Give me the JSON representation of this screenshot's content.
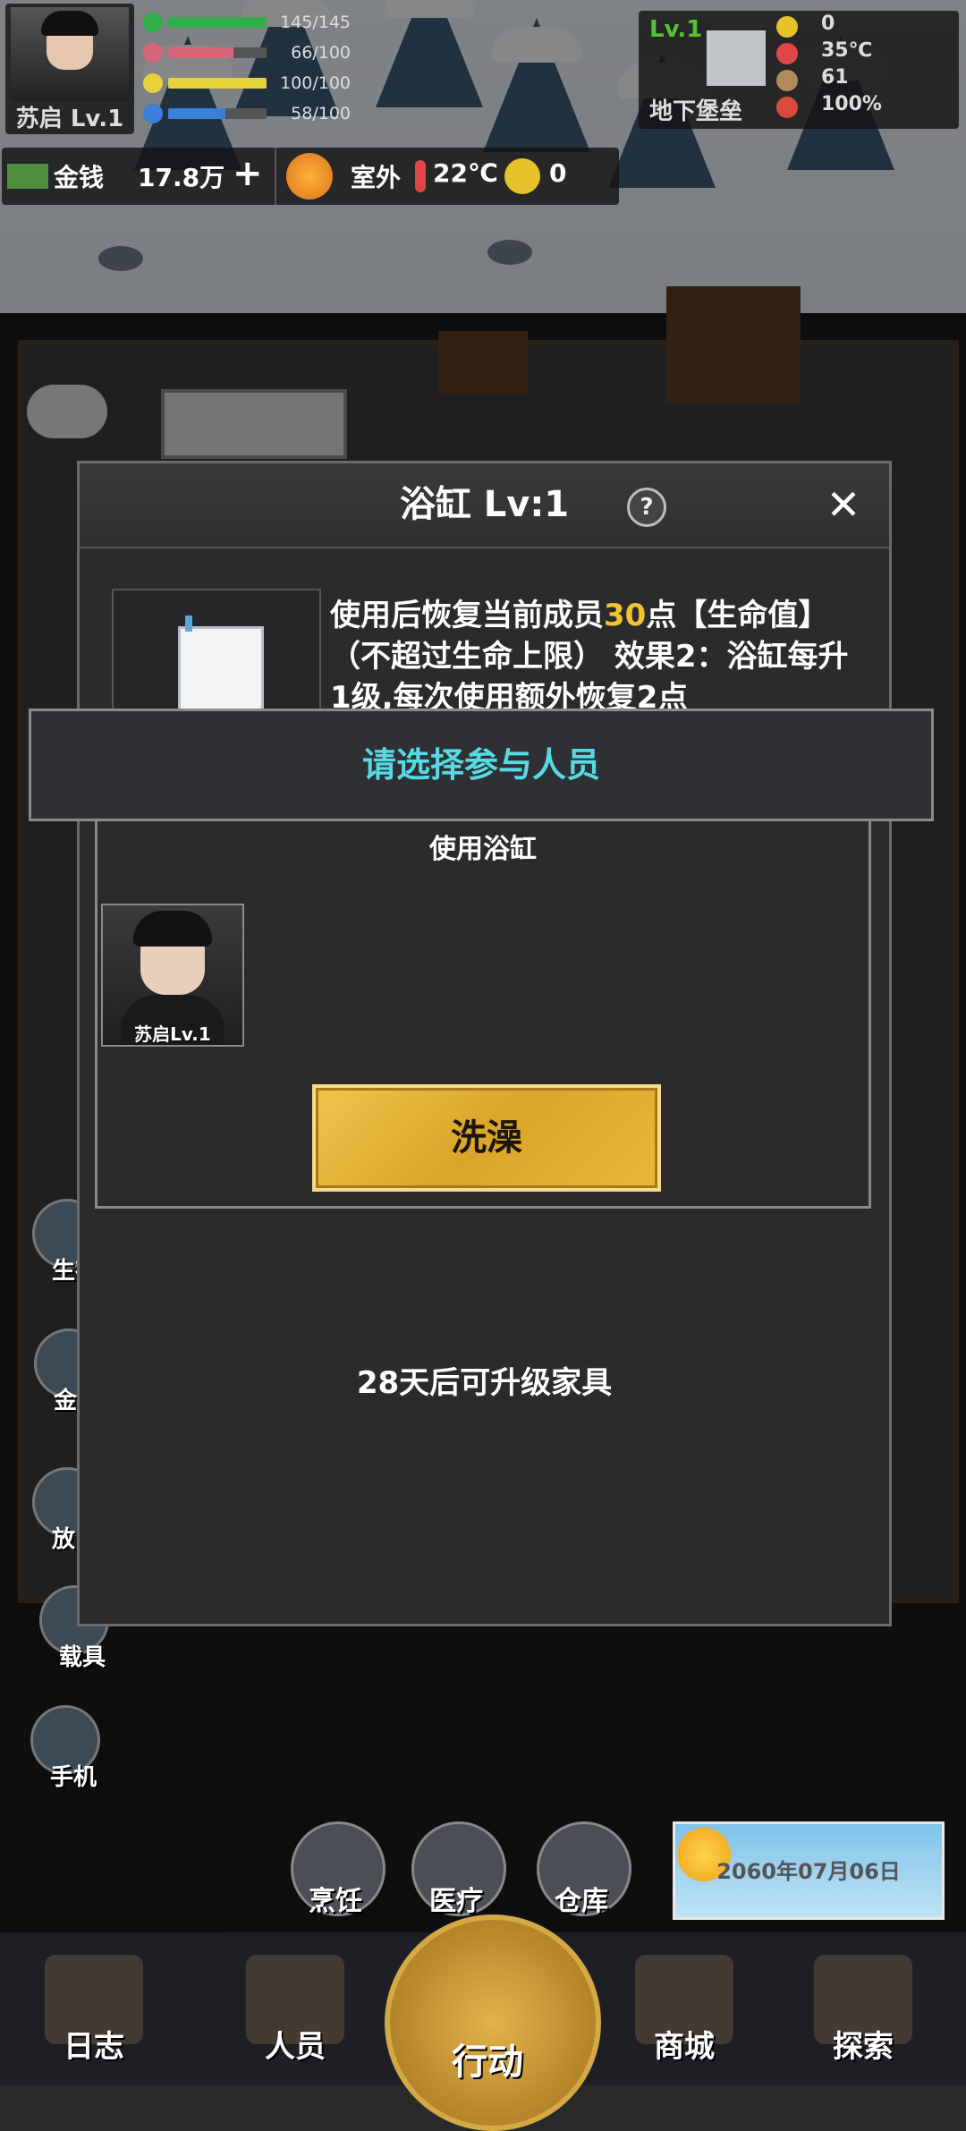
{
  "hud": {
    "player_name": "苏启 Lv.1",
    "stats": [
      {
        "value": "145/145",
        "color": "#2fae4a",
        "fill": 1.0,
        "icon": "heart-icon"
      },
      {
        "value": "66/100",
        "color": "#d9657a",
        "fill": 0.66,
        "icon": "stomach-icon"
      },
      {
        "value": "100/100",
        "color": "#e8d23a",
        "fill": 1.0,
        "icon": "energy-icon"
      },
      {
        "value": "58/100",
        "color": "#3a7fd9",
        "fill": 0.58,
        "icon": "water-icon"
      }
    ],
    "money_label": "金钱",
    "money_value": "17.8万",
    "outside_label": "室外",
    "outside_temp": "22℃",
    "outside_radiation": "0",
    "base_level": "Lv.1",
    "base_name": "地下堡垒",
    "base_stats": [
      {
        "icon": "radiation-icon",
        "value": "0"
      },
      {
        "icon": "thermometer-icon",
        "value": "35℃"
      },
      {
        "icon": "materials-icon",
        "value": "61"
      },
      {
        "icon": "durability-icon",
        "value": "100%"
      }
    ]
  },
  "side_menu": [
    "生存",
    "金",
    "放",
    "载具",
    "手机"
  ],
  "quick_actions": [
    "烹饪",
    "医疗",
    "仓库"
  ],
  "date": "2060年07月06日",
  "bottom_nav": [
    "日志",
    "人员",
    "行动",
    "商城",
    "探索"
  ],
  "dialog": {
    "title": "浴缸 Lv:1",
    "help": "?",
    "close": "✕",
    "desc_part1": "使用后恢复当前成员",
    "desc_highlight": "30",
    "desc_part2": "点【生命值】（不超过生命上限） 效果2：浴缸每升1级,每次使用额外恢复2点",
    "upgrade_text": "28天后可升级家具"
  },
  "selection": {
    "header": "请选择参与人员",
    "panel_title": "使用浴缸",
    "member_name": "苏启Lv.1",
    "action_button": "洗澡"
  }
}
